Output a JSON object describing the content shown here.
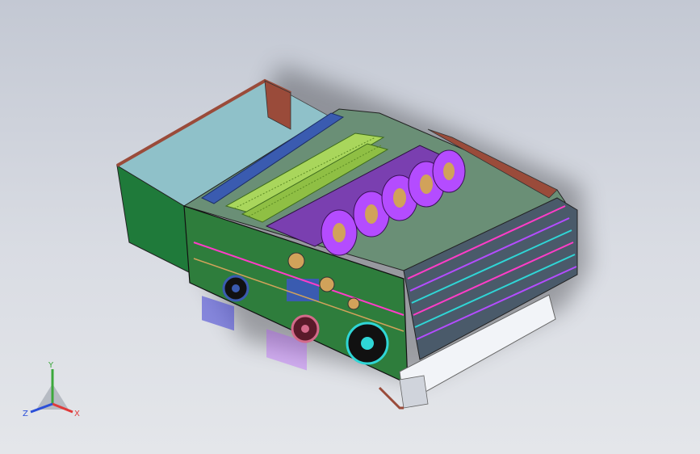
{
  "viewport": {
    "background_top": "#c3c8d3",
    "background_bottom": "#e4e6ea"
  },
  "model": {
    "name_icon": "textile-carding-machine-3d-model",
    "colors": {
      "hopper_wall": "#1f7a3a",
      "hopper_inner": "#7fb3bd",
      "frame_top": "#9a4b3a",
      "side_panel": "#2e7d3c",
      "drum_magenta": "#b44cff",
      "drum_band": "#d1a25a",
      "roller_green": "#a9d65c",
      "shaft_cyan": "#2fd6d6",
      "comb_pink": "#ff3cc8",
      "tray_white": "#f2f4f8",
      "shadow": "#1e1e22"
    }
  },
  "triad": {
    "y_label": "Y",
    "x_label": "X",
    "z_label": "Z",
    "y_color": "#3ca83c",
    "x_color": "#e03a3a",
    "z_color": "#2b4fd8"
  }
}
